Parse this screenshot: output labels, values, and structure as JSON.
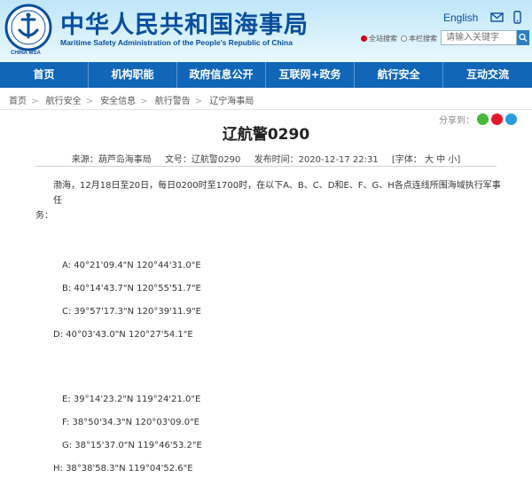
{
  "header": {
    "title": "中华人民共和国海事局",
    "subtitle": "Maritime Safety Administration of the People's Republic of China",
    "logo_text": "CHINA MSA",
    "english_link": "English",
    "search_options": [
      "全站搜索",
      "本栏搜索"
    ],
    "search_placeholder": "请输入关键字"
  },
  "nav": {
    "items": [
      "首页",
      "机构职能",
      "政府信息公开",
      "互联网+政务",
      "航行安全",
      "互动交流"
    ]
  },
  "breadcrumb": [
    "首页",
    "航行安全",
    "安全信息",
    "航行警告",
    "辽宁海事局"
  ],
  "share": {
    "label": "分享到："
  },
  "article": {
    "title": "辽航警0290",
    "meta": {
      "source": "来源：葫芦岛海事局",
      "doc_no": "文号：辽航警0290",
      "published": "发布时间：2020-12-17 22:31",
      "font_size": "[字体： 大  中  小]"
    },
    "intro_line1": "渤海，12月18日至20日，每日0200时至1700时，在以下A、B、C、D和E、F、G、H各点连线所围海域执行军事任",
    "intro_line2": "务：",
    "coordinates": [
      "A: 40°21'09.4\"N 120°44'31.0\"E",
      "B: 40°14'43.7\"N 120°55'51.7\"E",
      "C: 39°57'17.3\"N 120°39'11.9\"E",
      "D: 40°03'43.0\"N 120°27'54.1\"E",
      "E: 39°14'23.2\"N 119°24'21.0\"E",
      "F: 38°50'34.3\"N 120°03'09.0\"E",
      "G: 38°15'37.0\"N 119°46'53.2\"E",
      "H: 38°38'58.3\"N 119°04'52.6\"E"
    ]
  },
  "colors": {
    "nav_bg": "#1166b8",
    "brand": "#0a4f9e",
    "header_bg": "#d9f1fb"
  },
  "icons": [
    "msa-logo-icon",
    "mail-icon",
    "mobile-icon",
    "search-icon",
    "wechat-icon",
    "weibo-icon",
    "qzone-icon"
  ]
}
